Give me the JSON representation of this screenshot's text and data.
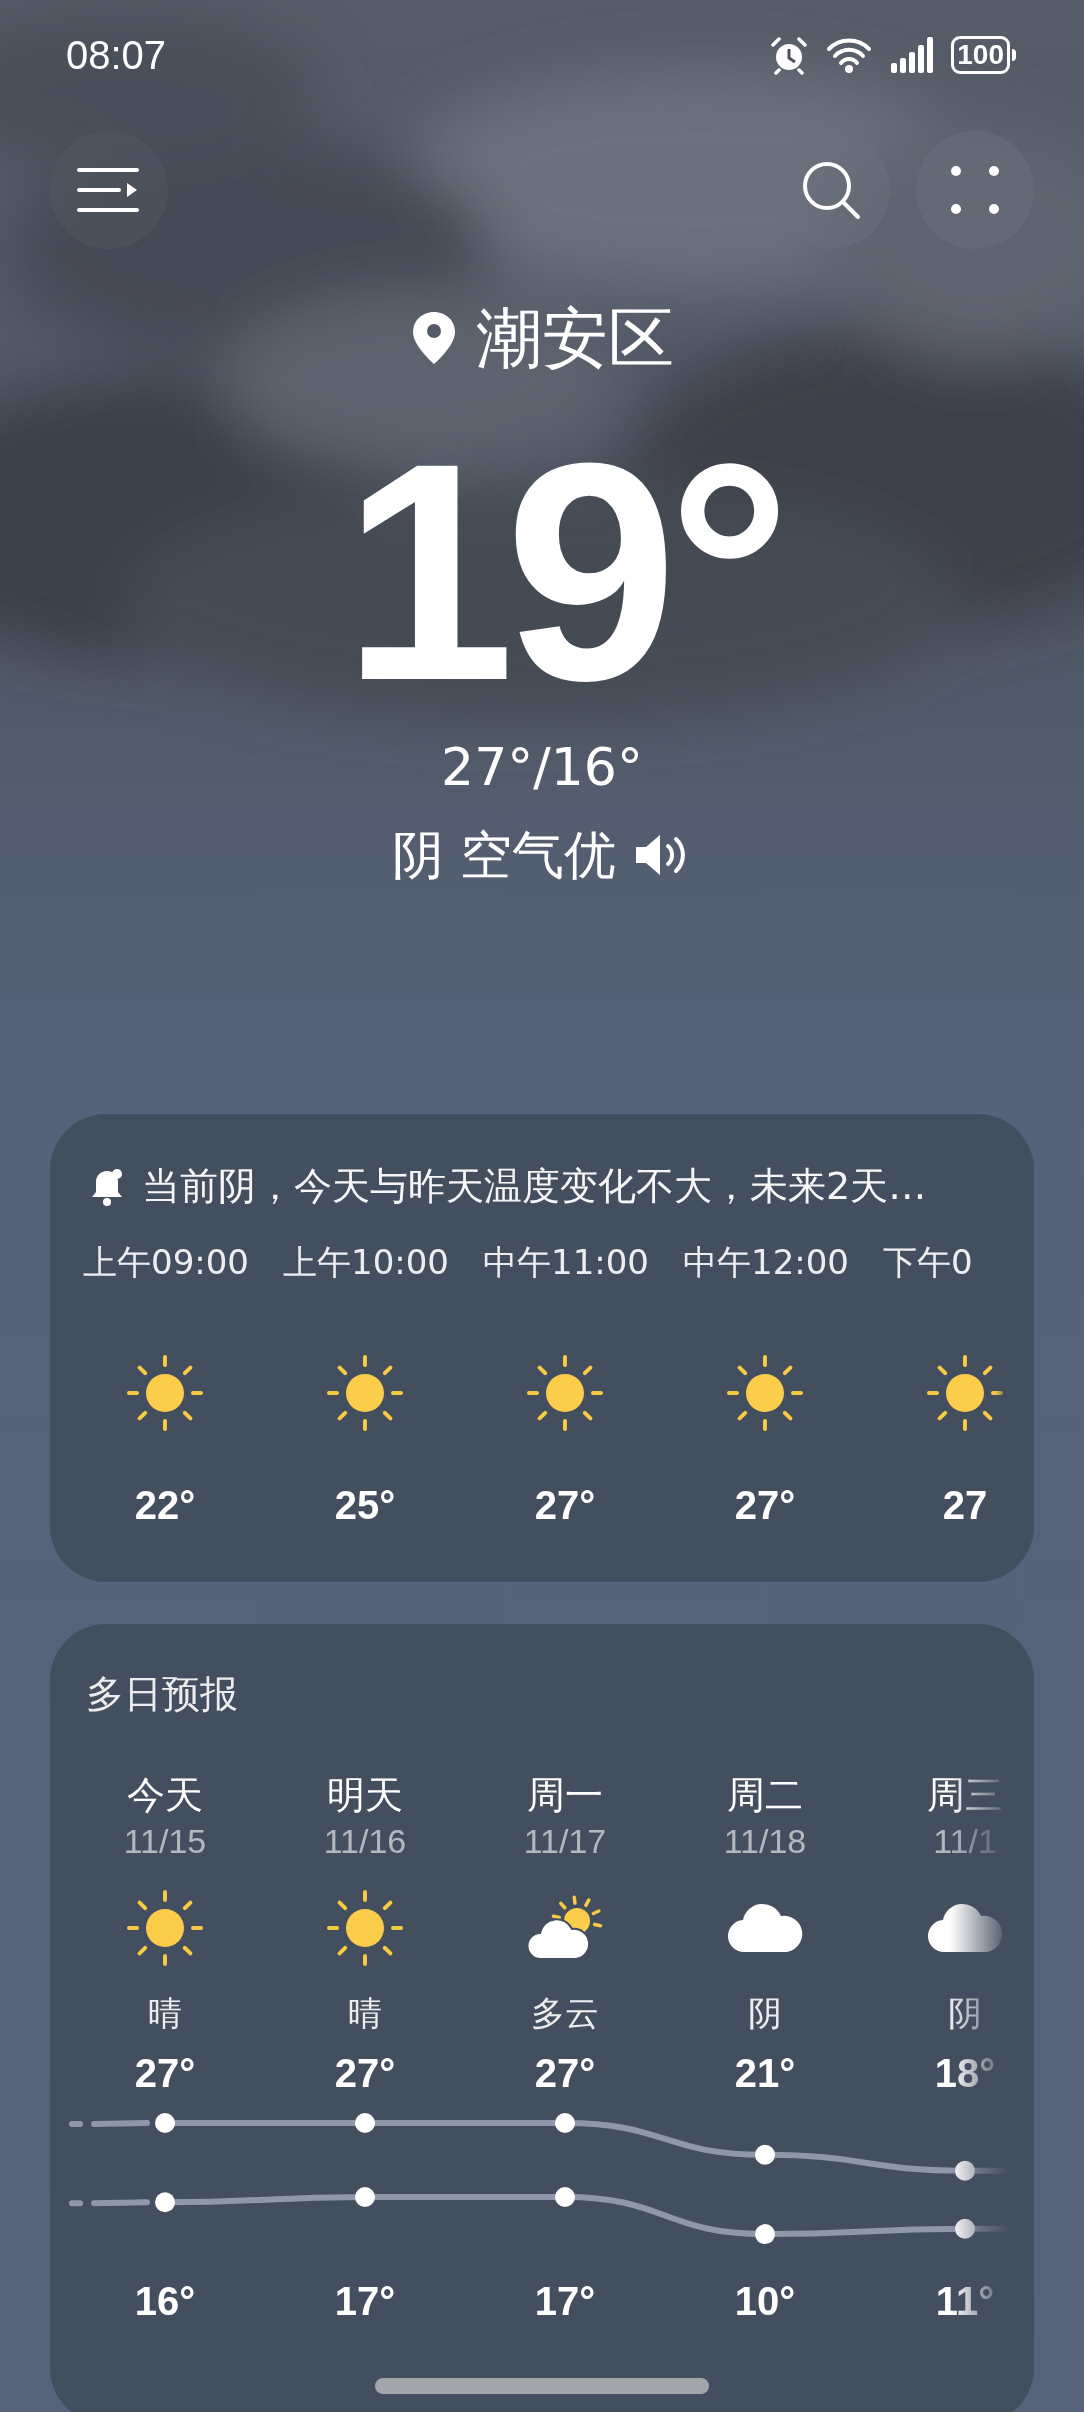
{
  "status_bar": {
    "time": "08:07",
    "battery": "100"
  },
  "location": "潮安区",
  "temperature": "19°",
  "range": "27°/16°",
  "weather": "阴",
  "air": "空气优",
  "hourly": {
    "summary": "当前阴，今天与昨天温度变化不大，未来2天…",
    "hours": [
      {
        "time": "上午09:00",
        "kind": "sunny",
        "temp": "22°"
      },
      {
        "time": "上午10:00",
        "kind": "sunny",
        "temp": "25°"
      },
      {
        "time": "中午11:00",
        "kind": "sunny",
        "temp": "27°"
      },
      {
        "time": "中午12:00",
        "kind": "sunny",
        "temp": "27°"
      },
      {
        "time": "下午0",
        "kind": "sunny",
        "temp": "27"
      }
    ]
  },
  "daily": {
    "title": "多日预报",
    "days": [
      {
        "day": "今天",
        "date": "11/15",
        "kind": "sunny",
        "condition": "晴",
        "high": "27°",
        "low": "16°"
      },
      {
        "day": "明天",
        "date": "11/16",
        "kind": "sunny",
        "condition": "晴",
        "high": "27°",
        "low": "17°"
      },
      {
        "day": "周一",
        "date": "11/17",
        "kind": "partly",
        "condition": "多云",
        "high": "27°",
        "low": "17°"
      },
      {
        "day": "周二",
        "date": "11/18",
        "kind": "cloudy",
        "condition": "阴",
        "high": "21°",
        "low": "10°"
      },
      {
        "day": "周三",
        "date": "11/1",
        "kind": "cloudy",
        "condition": "阴",
        "high": "18°",
        "low": "11°"
      }
    ]
  }
}
